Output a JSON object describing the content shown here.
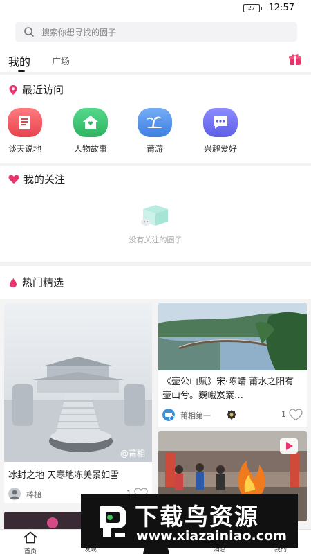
{
  "status": {
    "battery": "27",
    "time": "12:57"
  },
  "search": {
    "placeholder": "搜索你想寻找的圈子",
    "icon": "search-icon"
  },
  "tabs": {
    "mine": "我的",
    "plaza": "广场"
  },
  "header": {
    "gift_icon": "gift-icon"
  },
  "recent": {
    "title": "最近访问",
    "items": [
      {
        "label": "谈天说地",
        "icon": "chat-book-icon",
        "color": "#ef5a62"
      },
      {
        "label": "人物故事",
        "icon": "house-icon",
        "color": "#3cc36f"
      },
      {
        "label": "莆游",
        "icon": "palm-island-icon",
        "color": "#4f8fea"
      },
      {
        "label": "兴趣爱好",
        "icon": "message-icon",
        "color": "#6f6ff0"
      }
    ]
  },
  "follow": {
    "title": "我的关注",
    "empty_text": "没有关注的圈子"
  },
  "hot": {
    "title": "热门精选",
    "cards": [
      {
        "title": "冰封之地 天寒地冻美景如雪",
        "author": "棒槌",
        "likes": "1",
        "image_watermark": "@莆相"
      },
      {
        "title": "《壶公山赋》宋·陈靖 莆水之阳有壶山兮。巍峨岌嶪…",
        "author": "莆相第一",
        "likes": "1"
      }
    ]
  },
  "nav": {
    "home": "首页",
    "discover": "发现",
    "messages": "消息",
    "mine": "我的"
  },
  "watermark": {
    "cn": "下载鸟资源",
    "en": "www.xiazainiao.com"
  },
  "colors": {
    "accent": "#e8336d"
  }
}
